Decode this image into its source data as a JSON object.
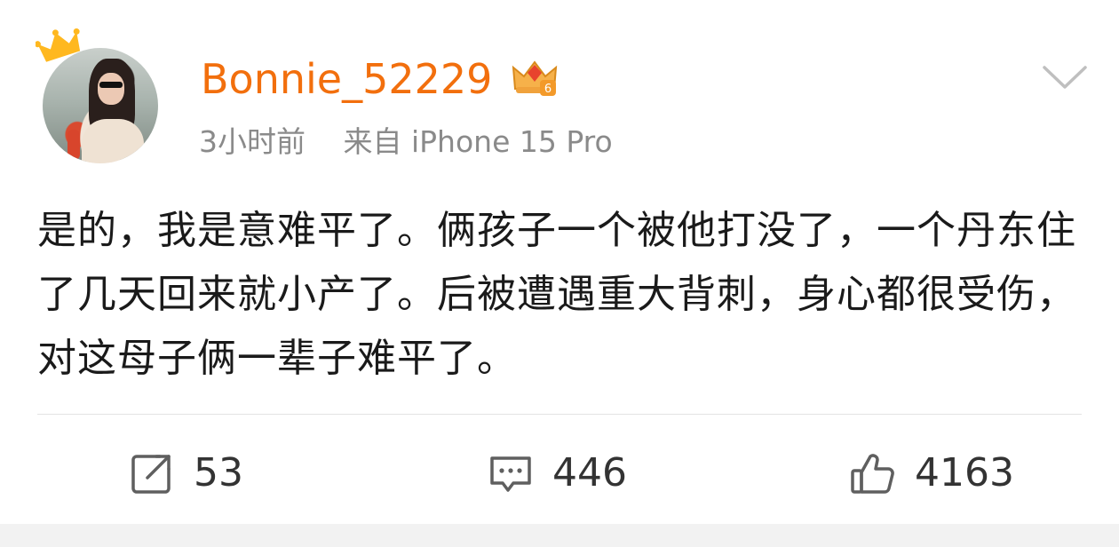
{
  "post": {
    "username": "Bonnie_52229",
    "time": "3小时前",
    "source": "来自 iPhone 15 Pro",
    "text": "是的，我是意难平了。俩孩子一个被他打没了，一个丹东住了几天回来就小产了。后被遭遇重大背刺，身心都很受伤，对这母子俩一辈子难平了。",
    "vip_badge_level": "6"
  },
  "actions": {
    "repost_count": "53",
    "comment_count": "446",
    "like_count": "4163"
  },
  "icons": {
    "avatar_crown": "crown-icon",
    "vip": "vip-crown-icon",
    "menu": "chevron-down-icon",
    "repost": "repost-icon",
    "comment": "comment-icon",
    "like": "thumbs-up-icon"
  },
  "colors": {
    "username": "#f26f0d",
    "crown": "#ffb81f",
    "meta_text": "#8a8a8a",
    "body_text": "#1a1a1a",
    "icon_gray": "#5f5f5f"
  }
}
